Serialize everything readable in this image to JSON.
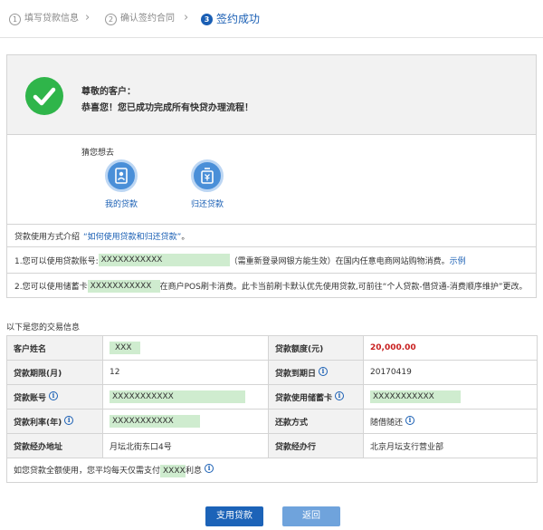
{
  "steps": [
    {
      "num": "1",
      "label": "填写贷款信息"
    },
    {
      "num": "2",
      "label": "确认签约合同"
    },
    {
      "num": "3",
      "label": "签约成功"
    }
  ],
  "success": {
    "line1": "尊敬的客户：",
    "line2": "恭喜您！您已成功完成所有快贷办理流程！"
  },
  "guess": {
    "title": "猜您想去",
    "items": [
      {
        "label": "我的贷款",
        "icon": "my-loan-icon"
      },
      {
        "label": "归还贷款",
        "icon": "repay-loan-icon"
      }
    ]
  },
  "usage": {
    "intro": "贷款使用方式介绍",
    "intro_link": "“如何使用贷款和归还贷款”",
    "intro_end": "。",
    "line1_prefix": "1.您可以使用贷款账号:",
    "line1_mask": "XXXXXXXXXXX",
    "line1_suffix": "（需重新登录网银方能生效）在国内任意电商网站购物消费。",
    "line1_link": "示例",
    "line2_prefix": "2.您可以使用储蓄卡",
    "line2_mask": "XXXXXXXXXXX",
    "line2_suffix": "在商户POS刷卡消费。此卡当前刷卡默认优先使用贷款,可前往“个人贷款-借贷通-消费顺序维护”更改。"
  },
  "tx": {
    "title": "以下是您的交易信息",
    "rows": [
      {
        "k1": "客户姓名",
        "v1": "XXX",
        "k2": "贷款额度(元)",
        "v2": "20,000.00"
      },
      {
        "k1": "贷款期限(月)",
        "v1": "12",
        "k2": "贷款到期日",
        "v2": "20170419"
      },
      {
        "k1": "贷款账号",
        "v1": "XXXXXXXXXXX",
        "k2": "贷款使用储蓄卡",
        "v2": "XXXXXXXXXXX"
      },
      {
        "k1": "贷款利率(年)",
        "v1": "XXXXXXXXXXX",
        "k2": "还款方式",
        "v2": "随借随还"
      },
      {
        "k1": "贷款经办地址",
        "v1": "月坛北街东口4号",
        "k2": "贷款经办行",
        "v2": "北京月坛支行营业部"
      }
    ],
    "footer_prefix": "如您贷款全额使用，您平均每天仅需支付",
    "footer_mask": "XXXX",
    "footer_suffix": "利息"
  },
  "buttons": {
    "use": "支用贷款",
    "back": "返回"
  },
  "colors": {
    "accent": "#1c63b8",
    "success": "#2fb54a",
    "amount": "#c81e1e",
    "mask": "#cfeccf"
  }
}
